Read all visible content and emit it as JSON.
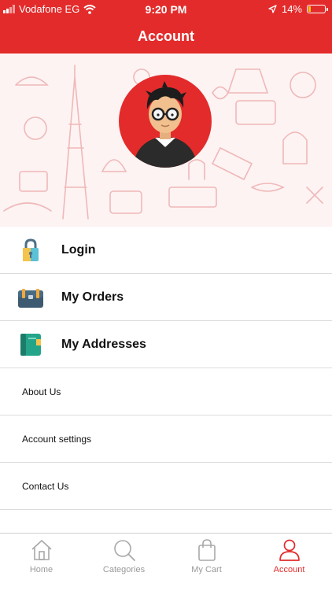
{
  "status_bar": {
    "carrier": "Vodafone EG",
    "time": "9:20 PM",
    "battery_text": "14%",
    "battery_level": 0.14
  },
  "header": {
    "title": "Account"
  },
  "menu": {
    "primary": [
      {
        "label": "Login",
        "icon": "lock-icon"
      },
      {
        "label": "My Orders",
        "icon": "briefcase-icon"
      },
      {
        "label": "My Addresses",
        "icon": "notebook-icon"
      }
    ],
    "secondary": [
      {
        "label": "About Us"
      },
      {
        "label": "Account settings"
      },
      {
        "label": "Contact Us"
      }
    ]
  },
  "tabbar": {
    "tabs": [
      {
        "label": "Home",
        "icon": "home-icon"
      },
      {
        "label": "Categories",
        "icon": "search-icon"
      },
      {
        "label": "My Cart",
        "icon": "shopping-bag-icon"
      },
      {
        "label": "Account",
        "icon": "user-icon"
      }
    ],
    "active": "Account"
  },
  "colors": {
    "accent": "#e32b2b",
    "inactive": "#999999",
    "divider": "#dcdcdc"
  }
}
